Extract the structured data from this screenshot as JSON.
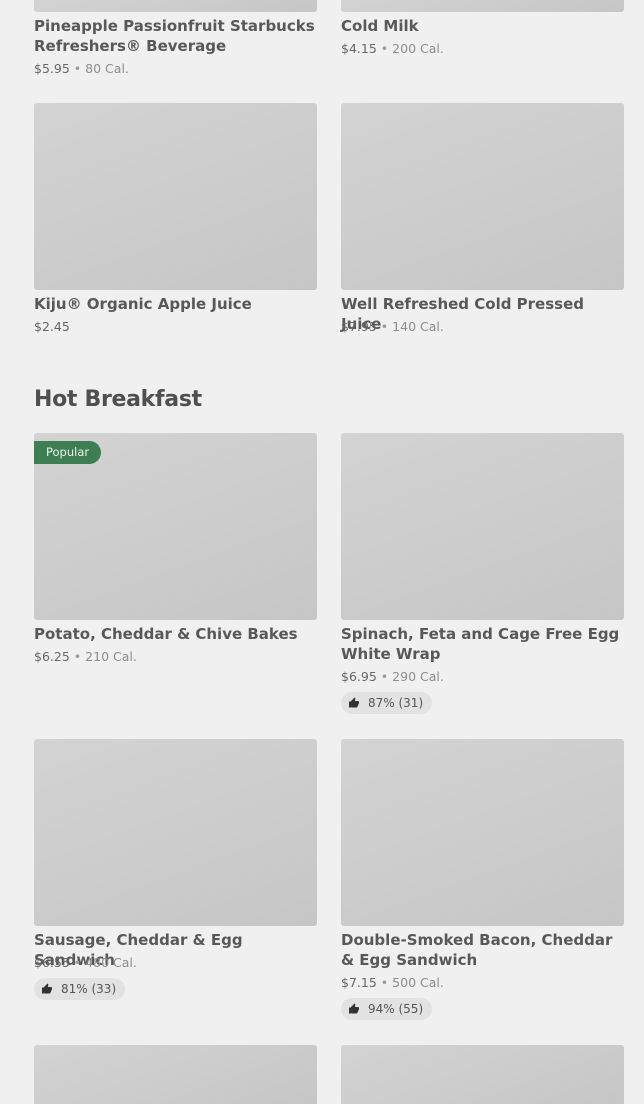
{
  "sections": {
    "hot_breakfast_title": "Hot Breakfast"
  },
  "items": {
    "pineapple": {
      "name": "Pineapple Passionfruit Starbucks Refreshers® Beverage",
      "price": "$5.95",
      "calories": "80 Cal."
    },
    "cold_milk": {
      "name": "Cold Milk",
      "price": "$4.15",
      "calories": "200 Cal."
    },
    "kiju": {
      "name": "Kiju® Organic Apple Juice",
      "price": "$2.45"
    },
    "well_refreshed": {
      "name": "Well Refreshed Cold Pressed Juice",
      "price": "$7.95",
      "calories": "140 Cal."
    },
    "potato": {
      "name": "Potato, Cheddar & Chive Bakes",
      "price": "$6.25",
      "calories": "210 Cal.",
      "badge": "Popular"
    },
    "spinach": {
      "name": "Spinach, Feta and Cage Free Egg White Wrap",
      "price": "$6.95",
      "calories": "290 Cal.",
      "rating": "87% (31)"
    },
    "sausage": {
      "name": "Sausage, Cheddar & Egg Sandwich",
      "price": "$6.55",
      "calories": "480 Cal.",
      "rating": "81% (33)"
    },
    "bacon": {
      "name": "Double-Smoked Bacon, Cheddar & Egg Sandwich",
      "price": "$7.15",
      "calories": "500 Cal.",
      "rating": "94% (55)"
    }
  },
  "separator": "•",
  "icons": {
    "rating": "thumbs-up-icon"
  },
  "colors": {
    "badge_bg": "#3d7e52",
    "rating_bg": "#e2e2e2",
    "image_placeholder": "#cccccc"
  }
}
